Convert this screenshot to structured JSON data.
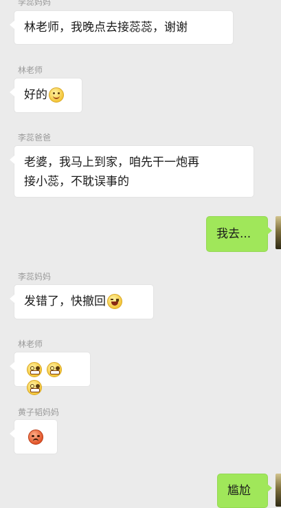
{
  "chat": {
    "messages": [
      {
        "sender": "李蕊妈妈",
        "text": "林老师，我晚点去接蕊蕊，谢谢",
        "side": "left"
      },
      {
        "sender": "林老师",
        "text": "好的",
        "emoji": "smile-icon",
        "side": "left"
      },
      {
        "sender": "李蕊爸爸",
        "line1": "老婆，我马上到家，咱先干一炮再",
        "line2": "接小蕊，不耽误事的",
        "side": "left"
      },
      {
        "text": "我去...",
        "side": "right"
      },
      {
        "sender": "李蕊妈妈",
        "text": "发错了，快撤回",
        "emoji": "laugh-icon",
        "side": "left"
      },
      {
        "sender": "林老师",
        "emoji": "grin-icon",
        "emoji_count": 3,
        "side": "left"
      },
      {
        "sender": "黄子韬妈妈",
        "emoji": "angry-icon",
        "side": "left"
      },
      {
        "text": "尴尬",
        "side": "right"
      }
    ]
  },
  "colors": {
    "background": "#ebebeb",
    "bubble_left": "#ffffff",
    "bubble_right": "#a0e75a",
    "sender_name": "#9a9a9a"
  }
}
